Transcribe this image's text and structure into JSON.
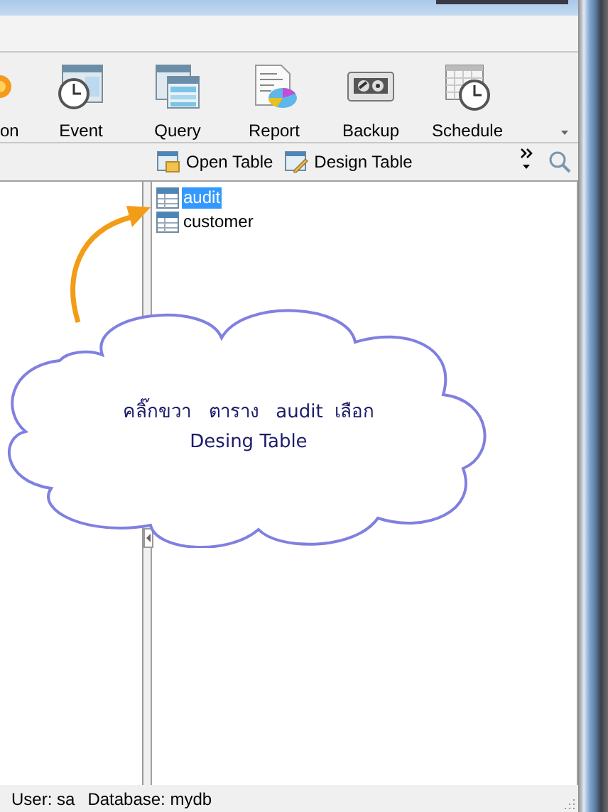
{
  "toolbar": {
    "items": [
      {
        "label": "on",
        "kind": "partial"
      },
      {
        "label": "Event",
        "kind": "event"
      },
      {
        "label": "Query",
        "kind": "query"
      },
      {
        "label": "Report",
        "kind": "report"
      },
      {
        "label": "Backup",
        "kind": "backup"
      },
      {
        "label": "Schedule",
        "kind": "schedule"
      }
    ]
  },
  "object_toolbar": {
    "buttons": [
      {
        "label": "Open Table",
        "kind": "open"
      },
      {
        "label": "Design Table",
        "kind": "design"
      }
    ]
  },
  "tables": [
    {
      "name": "audit",
      "selected": true
    },
    {
      "name": "customer",
      "selected": false
    }
  ],
  "callout": {
    "lines": [
      "คลิ๊กขวา   ตาราง   audit  เลือก",
      "Desing Table"
    ]
  },
  "status_bar": {
    "user": "User: sa",
    "database": "Database: mydb"
  }
}
